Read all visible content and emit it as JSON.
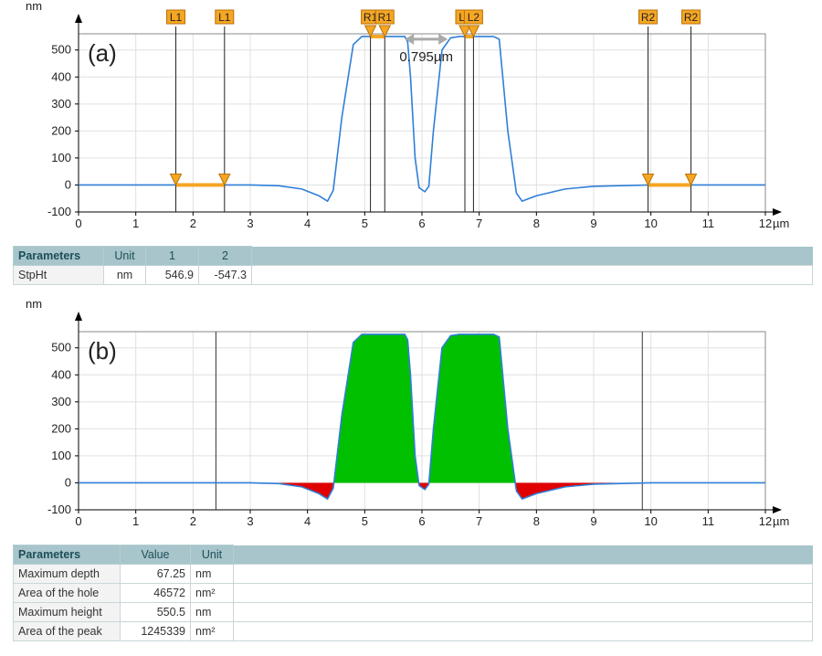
{
  "chart_data": [
    {
      "type": "line",
      "panel_label": "(a)",
      "xlabel": "µm",
      "ylabel": "nm",
      "xlim": [
        0,
        12
      ],
      "ylim": [
        -100,
        560
      ],
      "x_ticks": [
        "0",
        "1",
        "2",
        "3",
        "4",
        "5",
        "6",
        "7",
        "8",
        "9",
        "10",
        "11",
        "12"
      ],
      "y_ticks": [
        "-100",
        "0",
        "100",
        "200",
        "300",
        "400",
        "500"
      ],
      "grid": true,
      "series": [
        {
          "color": "#2f7fd8",
          "x": [
            0,
            1,
            2,
            3,
            3.5,
            3.9,
            4.2,
            4.35,
            4.45,
            4.6,
            4.8,
            4.95,
            5.7,
            5.75,
            5.8,
            5.88,
            5.95,
            6.05,
            6.12,
            6.2,
            6.35,
            6.5,
            6.65,
            7.25,
            7.35,
            7.5,
            7.65,
            7.75,
            8,
            8.5,
            9,
            10,
            11,
            12
          ],
          "y": [
            0,
            0,
            0,
            0,
            -3,
            -15,
            -40,
            -60,
            -20,
            250,
            520,
            550,
            550,
            530,
            400,
            100,
            -10,
            -25,
            -5,
            200,
            500,
            545,
            550,
            550,
            540,
            200,
            -30,
            -60,
            -40,
            -15,
            -5,
            0,
            0,
            0
          ]
        }
      ],
      "markers": [
        {
          "label": "L1",
          "x": 1.7,
          "cursor_y": 0
        },
        {
          "label": "L1",
          "x": 2.55,
          "cursor_y": 0
        },
        {
          "label": "R1",
          "x": 5.1,
          "cursor_y": 550
        },
        {
          "label": "R1",
          "x": 5.35,
          "cursor_y": 550
        },
        {
          "label": "L2",
          "x": 6.75,
          "cursor_y": 550
        },
        {
          "label": "L2",
          "x": 6.9,
          "cursor_y": 550
        },
        {
          "label": "R2",
          "x": 9.95,
          "cursor_y": 0
        },
        {
          "label": "R2",
          "x": 10.7,
          "cursor_y": 0
        }
      ],
      "annotation": {
        "text": "0.795µm",
        "x1": 5.7,
        "x2": 6.45,
        "y": 540
      }
    },
    {
      "type": "area",
      "panel_label": "(b)",
      "xlabel": "µm",
      "ylabel": "nm",
      "xlim": [
        0,
        12
      ],
      "ylim": [
        -100,
        560
      ],
      "x_ticks": [
        "0",
        "1",
        "2",
        "3",
        "4",
        "5",
        "6",
        "7",
        "8",
        "9",
        "10",
        "11",
        "12"
      ],
      "y_ticks": [
        "-100",
        "0",
        "100",
        "200",
        "300",
        "400",
        "500"
      ],
      "grid": true,
      "bounds_x": [
        2.4,
        9.85
      ],
      "series": [
        {
          "color": "#2f7fd8",
          "x": [
            0,
            1,
            2,
            3,
            3.5,
            3.9,
            4.2,
            4.35,
            4.45,
            4.6,
            4.8,
            4.95,
            5.7,
            5.75,
            5.8,
            5.88,
            5.95,
            6.05,
            6.12,
            6.2,
            6.35,
            6.5,
            6.65,
            7.25,
            7.35,
            7.5,
            7.65,
            7.75,
            8,
            8.5,
            9,
            10,
            11,
            12
          ],
          "y": [
            0,
            0,
            0,
            0,
            -3,
            -15,
            -40,
            -60,
            -20,
            250,
            520,
            550,
            550,
            530,
            400,
            100,
            -10,
            -25,
            -5,
            200,
            500,
            545,
            550,
            550,
            540,
            200,
            -30,
            -60,
            -40,
            -15,
            -5,
            0,
            0,
            0
          ]
        }
      ],
      "fill_positive_color": "#00c000",
      "fill_negative_color": "#e00000"
    }
  ],
  "table_a": {
    "headers": [
      "Parameters",
      "Unit",
      "1",
      "2"
    ],
    "rows": [
      {
        "param": "StpHt",
        "unit": "nm",
        "v1": "546.9",
        "v2": "-547.3"
      }
    ]
  },
  "table_b": {
    "headers": [
      "Parameters",
      "Value",
      "Unit"
    ],
    "rows": [
      {
        "param": "Maximum depth",
        "value": "67.25",
        "unit": "nm"
      },
      {
        "param": "Area of the hole",
        "value": "46572",
        "unit": "nm²"
      },
      {
        "param": "Maximum height",
        "value": "550.5",
        "unit": "nm"
      },
      {
        "param": "Area of the peak",
        "value": "1245339",
        "unit": "nm²"
      }
    ]
  },
  "colors": {
    "profile": "#2f7fd8",
    "marker_fill": "#f5a623",
    "marker_border": "#b8720a",
    "header_bg": "#a7c5ca",
    "peak_fill": "#00c000",
    "hole_fill": "#e00000"
  }
}
